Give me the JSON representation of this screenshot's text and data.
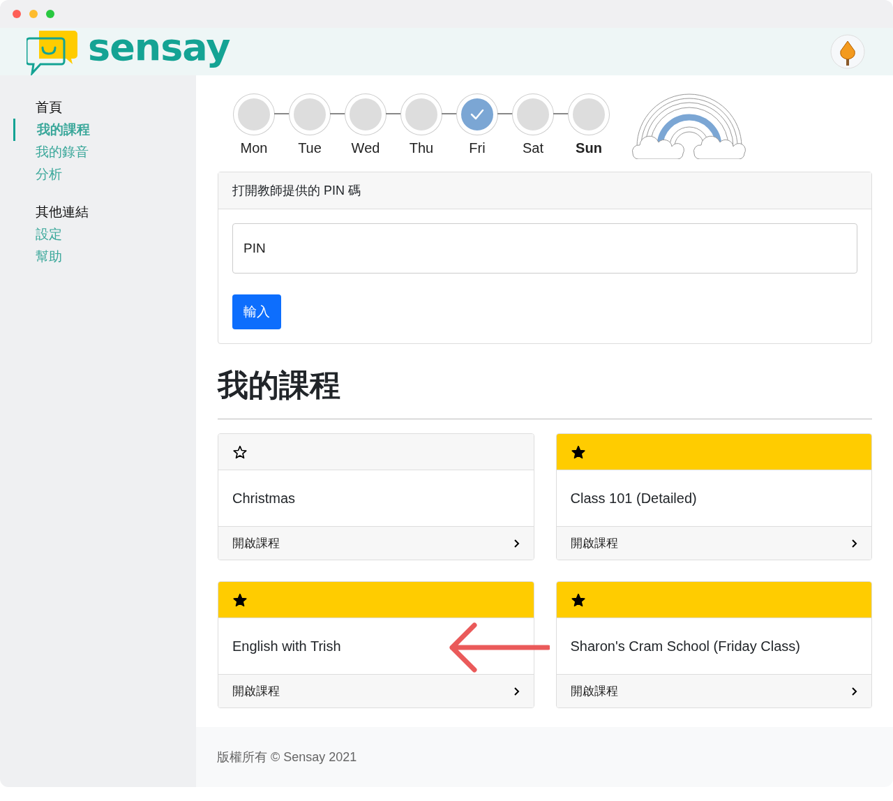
{
  "brand": "sensay",
  "sidebar": {
    "sections": [
      {
        "heading": "首頁",
        "items": [
          {
            "label": "我的課程",
            "selected": true
          },
          {
            "label": "我的錄音",
            "selected": false
          },
          {
            "label": "分析",
            "selected": false
          }
        ]
      },
      {
        "heading": "其他連結",
        "items": [
          {
            "label": "設定",
            "selected": false
          },
          {
            "label": "幫助",
            "selected": false
          }
        ]
      }
    ]
  },
  "week": [
    {
      "label": "Mon",
      "done": false,
      "today": false
    },
    {
      "label": "Tue",
      "done": false,
      "today": false
    },
    {
      "label": "Wed",
      "done": false,
      "today": false
    },
    {
      "label": "Thu",
      "done": false,
      "today": false
    },
    {
      "label": "Fri",
      "done": true,
      "today": false
    },
    {
      "label": "Sat",
      "done": false,
      "today": false
    },
    {
      "label": "Sun",
      "done": false,
      "today": true
    }
  ],
  "pin_panel": {
    "title": "打開教師提供的 PIN 碼",
    "placeholder": "PIN",
    "button": "輸入"
  },
  "heading": "我的課程",
  "courses": [
    {
      "name": "Christmas",
      "starred": false,
      "action": "開啟課程"
    },
    {
      "name": "Class 101 (Detailed)",
      "starred": true,
      "action": "開啟課程"
    },
    {
      "name": "English with Trish",
      "starred": true,
      "action": "開啟課程"
    },
    {
      "name": "Sharon's Cram School (Friday Class)",
      "starred": true,
      "action": "開啟課程"
    }
  ],
  "footer": "版權所有 © Sensay 2021"
}
